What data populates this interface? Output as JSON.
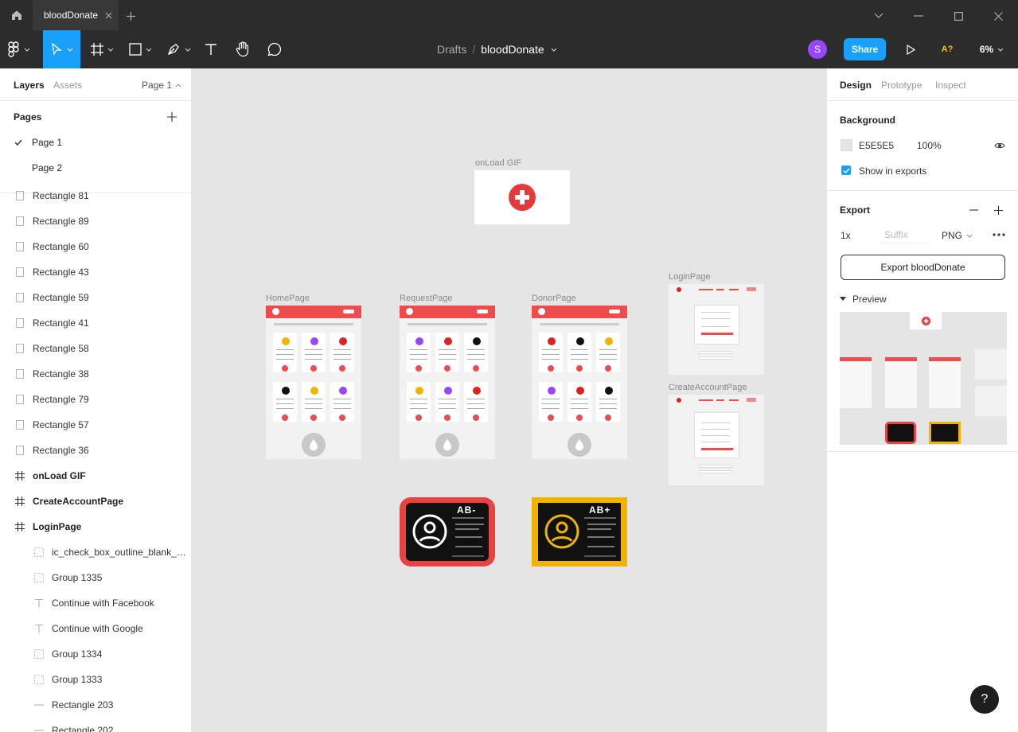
{
  "tab": {
    "title": "bloodDonate"
  },
  "toolbar": {
    "breadcrumb_parent": "Drafts",
    "breadcrumb_sep": "/",
    "file_name": "bloodDonate",
    "avatar_initial": "S",
    "share_label": "Share",
    "a11y_label": "A?",
    "zoom": "6%"
  },
  "left": {
    "tab_layers": "Layers",
    "tab_assets": "Assets",
    "page_selector": "Page 1",
    "pages_title": "Pages",
    "pages": [
      {
        "label": "Page 1",
        "active": true
      },
      {
        "label": "Page 2",
        "active": false
      }
    ],
    "layers": [
      {
        "label": "Rectangle 81",
        "type": "rect"
      },
      {
        "label": "Rectangle 89",
        "type": "rect"
      },
      {
        "label": "Rectangle 60",
        "type": "rect"
      },
      {
        "label": "Rectangle 43",
        "type": "rect"
      },
      {
        "label": "Rectangle 59",
        "type": "rect"
      },
      {
        "label": "Rectangle 41",
        "type": "rect"
      },
      {
        "label": "Rectangle 58",
        "type": "rect"
      },
      {
        "label": "Rectangle 38",
        "type": "rect"
      },
      {
        "label": "Rectangle 79",
        "type": "rect"
      },
      {
        "label": "Rectangle 57",
        "type": "rect"
      },
      {
        "label": "Rectangle 36",
        "type": "rect"
      },
      {
        "label": "onLoad GIF",
        "type": "frame"
      },
      {
        "label": "CreateAccountPage",
        "type": "frame"
      },
      {
        "label": "LoginPage",
        "type": "frame"
      },
      {
        "label": "ic_check_box_outline_blank_2...",
        "type": "group"
      },
      {
        "label": "Group 1335",
        "type": "group"
      },
      {
        "label": "Continue with Facebook",
        "type": "text"
      },
      {
        "label": "Continue with Google",
        "type": "text"
      },
      {
        "label": "Group 1334",
        "type": "group"
      },
      {
        "label": "Group 1333",
        "type": "group"
      },
      {
        "label": "Rectangle 203",
        "type": "line"
      },
      {
        "label": "Rectangle 202",
        "type": "line"
      }
    ]
  },
  "right": {
    "tab_design": "Design",
    "tab_prototype": "Prototype",
    "tab_inspect": "Inspect",
    "background_title": "Background",
    "bg_hex": "E5E5E5",
    "bg_opacity": "100%",
    "show_in_exports": "Show in exports",
    "export_title": "Export",
    "export_scale": "1x",
    "export_suffix_placeholder": "Suffix",
    "export_format": "PNG",
    "export_button": "Export bloodDonate",
    "preview_label": "Preview"
  },
  "canvas": {
    "onload_label": "onLoad GIF",
    "homepage_label": "HomePage",
    "requestpage_label": "RequestPage",
    "donorpage_label": "DonorPage",
    "loginpage_label": "LoginPage",
    "createaccount_label": "CreateAccountPage",
    "card1_blood": "AB-",
    "card2_blood": "AB+"
  },
  "colors": {
    "accent_blue": "#18a0fb",
    "brand_red": "#ee4c4c",
    "card_yellow": "#f0b400",
    "avatar_purple": "#9747ff",
    "dark_bar": "#2c2c2c"
  },
  "help": {
    "label": "?"
  }
}
